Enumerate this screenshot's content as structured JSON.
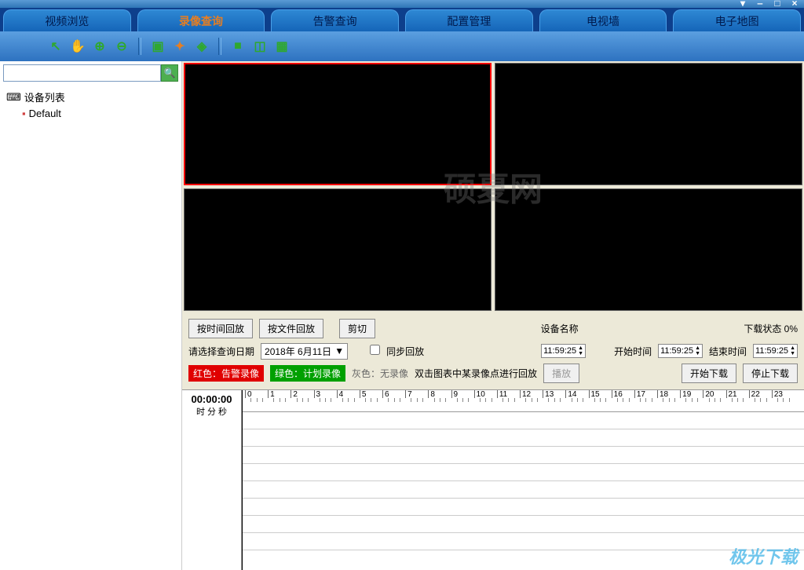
{
  "window": {
    "min": "‒",
    "max": "□",
    "close": "×",
    "menu": "▾"
  },
  "tabs": [
    {
      "label": "视频浏览"
    },
    {
      "label": "录像查询"
    },
    {
      "label": "告警查询"
    },
    {
      "label": "配置管理"
    },
    {
      "label": "电视墙"
    },
    {
      "label": "电子地图"
    }
  ],
  "sidebar": {
    "root_label": "设备列表",
    "child_label": "Default"
  },
  "buttons": {
    "by_time": "按时间回放",
    "by_file": "按文件回放",
    "cut": "剪切",
    "play": "播放",
    "start_dl": "开始下载",
    "stop_dl": "停止下载"
  },
  "labels": {
    "device_name": "设备名称",
    "download_status": "下载状态 0%",
    "select_date": "请选择查询日期",
    "sync_play": "同步回放",
    "start_time": "开始时间",
    "end_time": "结束时间",
    "legend_red": "红色：告警录像",
    "legend_green": "绿色：计划录像",
    "legend_gray": "灰色：无录像",
    "legend_hint": "双击图表中某录像点进行回放"
  },
  "values": {
    "date": "2018年 6月11日",
    "time1": "11:59:25",
    "time2": "11:59:25",
    "time3": "11:59:25"
  },
  "timeline": {
    "display": "00:00:00",
    "sub": "时 分 秒",
    "hours": [
      "0",
      "1",
      "2",
      "3",
      "4",
      "5",
      "6",
      "7",
      "8",
      "9",
      "10",
      "11",
      "12",
      "13",
      "14",
      "15",
      "16",
      "17",
      "18",
      "19",
      "20",
      "21",
      "22",
      "23"
    ]
  },
  "watermark": "硕夏网",
  "footer": "极光下载"
}
